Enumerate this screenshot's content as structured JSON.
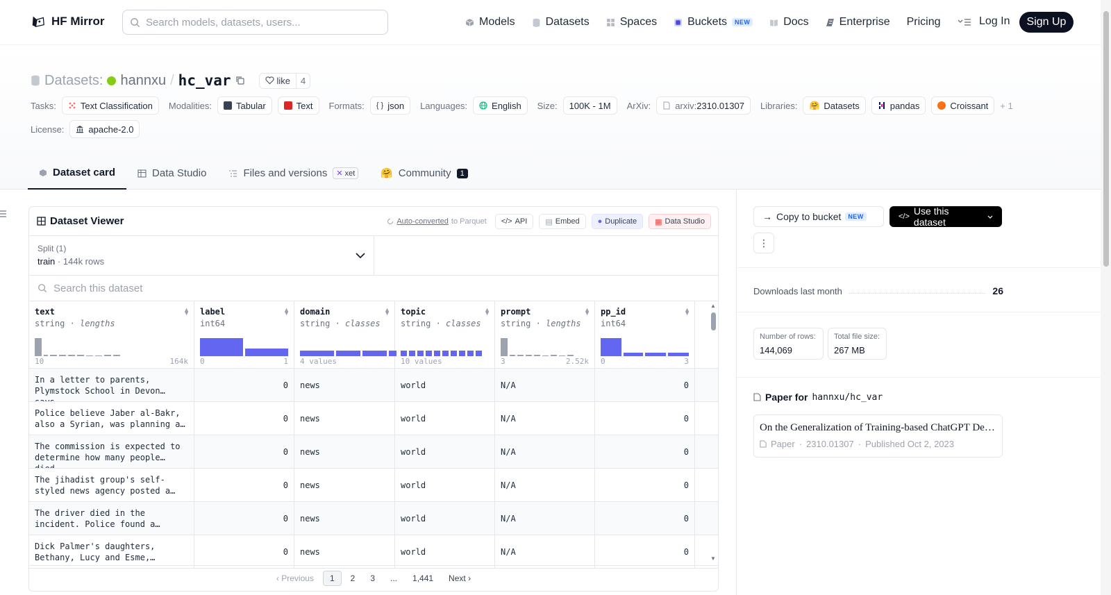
{
  "header": {
    "brand": "HF Mirror",
    "search_placeholder": "Search models, datasets, users...",
    "nav": [
      {
        "label": "Models",
        "icon": "cube-icon",
        "color": "#6b7280"
      },
      {
        "label": "Datasets",
        "icon": "database-icon",
        "color": "#9ca3af"
      },
      {
        "label": "Spaces",
        "icon": "grid-icon",
        "color": "#9ca3af"
      },
      {
        "label": "Buckets",
        "icon": "bucket-icon",
        "color": "#4f46e5",
        "badge": "NEW"
      },
      {
        "label": "Docs",
        "icon": "book-icon",
        "color": "#9ca3af"
      },
      {
        "label": "Enterprise",
        "icon": "enterprise-icon",
        "color": "#6b7280"
      },
      {
        "label": "Pricing"
      }
    ],
    "login": "Log In",
    "signup": "Sign Up"
  },
  "repo": {
    "type_label": "Datasets:",
    "owner": "hannxu",
    "separator": "/",
    "name": "hc_var",
    "like_label": "like",
    "like_count": "4"
  },
  "tags": {
    "tasks_label": "Tasks:",
    "tasks": [
      "Text Classification"
    ],
    "modalities_label": "Modalities:",
    "modalities": [
      "Tabular",
      "Text"
    ],
    "formats_label": "Formats:",
    "formats": [
      "json"
    ],
    "languages_label": "Languages:",
    "languages": [
      "English"
    ],
    "size_label": "Size:",
    "size": "100K - 1M",
    "arxiv_label": "ArXiv:",
    "arxiv_prefix": "arxiv:",
    "arxiv": "2310.01307",
    "libraries_label": "Libraries:",
    "libraries": [
      "Datasets",
      "pandas",
      "Croissant"
    ],
    "libraries_more": "+ 1",
    "license_label": "License:",
    "license": "apache-2.0"
  },
  "tabs": {
    "card": "Dataset card",
    "studio": "Data Studio",
    "files": "Files and versions",
    "xet": "xet",
    "community": "Community",
    "community_count": "1"
  },
  "viewer": {
    "title": "Dataset Viewer",
    "auto_converted": "Auto-converted",
    "to_parquet": "to Parquet",
    "api": "API",
    "embed": "Embed",
    "duplicate": "Duplicate",
    "data_studio": "Data Studio",
    "split_label": "Split (1)",
    "split_name": "train",
    "split_rows": "144k rows",
    "search_placeholder": "Search this dataset",
    "columns": [
      {
        "name": "text",
        "type": "string",
        "stat": "lengths",
        "min": "10",
        "max": "164k",
        "width": 238
      },
      {
        "name": "label",
        "type": "int64",
        "stat": "",
        "min": "0",
        "max": "1",
        "width": 144
      },
      {
        "name": "domain",
        "type": "string",
        "stat": "classes",
        "min": "4 values",
        "max": "",
        "width": 145
      },
      {
        "name": "topic",
        "type": "string",
        "stat": "classes",
        "min": "10 values",
        "max": "",
        "width": 144
      },
      {
        "name": "prompt",
        "type": "string",
        "stat": "lengths",
        "min": "3",
        "max": "2.52k",
        "width": 144
      },
      {
        "name": "pp_id",
        "type": "int64",
        "stat": "",
        "min": "0",
        "max": "3",
        "width": 144
      }
    ],
    "rows": [
      {
        "text": "In a letter to parents, Plymstock School in Devon says…",
        "label": "0",
        "domain": "news",
        "topic": "world",
        "prompt": "N/A",
        "pp_id": "0"
      },
      {
        "text": "Police believe Jaber al-Bakr, also a Syrian, was planning a…",
        "label": "0",
        "domain": "news",
        "topic": "world",
        "prompt": "N/A",
        "pp_id": "0"
      },
      {
        "text": "The commission is expected to determine how many people died…",
        "label": "0",
        "domain": "news",
        "topic": "world",
        "prompt": "N/A",
        "pp_id": "0"
      },
      {
        "text": "The jihadist group's self-styled news agency posted a…",
        "label": "0",
        "domain": "news",
        "topic": "world",
        "prompt": "N/A",
        "pp_id": "0"
      },
      {
        "text": "The driver died in the incident. Police found a…",
        "label": "0",
        "domain": "news",
        "topic": "world",
        "prompt": "N/A",
        "pp_id": "0"
      },
      {
        "text": "Dick Palmer's daughters, Bethany, Lucy and Esme,…",
        "label": "0",
        "domain": "news",
        "topic": "world",
        "prompt": "N/A",
        "pp_id": "0"
      }
    ],
    "pager": {
      "prev": "Previous",
      "pages": [
        "1",
        "2",
        "3",
        "...",
        "1,441"
      ],
      "next": "Next"
    }
  },
  "sidebar": {
    "copy_to_bucket": "Copy to bucket",
    "new_badge": "NEW",
    "use_dataset": "Use this dataset",
    "downloads_label": "Downloads last month",
    "downloads_value": "26",
    "rows_label": "Number of rows:",
    "rows_value": "144,069",
    "size_label": "Total file size:",
    "size_value": "267 MB",
    "paper_for": "Paper for",
    "paper_repo": "hannxu/hc_var",
    "paper_title": "On the Generalization of Training-based ChatGPT Detection Methods",
    "paper_kind": "Paper",
    "paper_id": "2310.01307",
    "paper_published": "Published Oct 2, 2023"
  }
}
